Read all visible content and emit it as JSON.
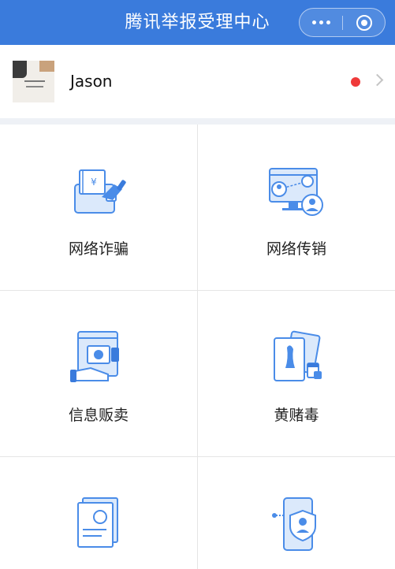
{
  "header": {
    "title": "腾讯举报受理中心",
    "more_icon": "more-dots-icon",
    "close_icon": "miniprogram-close-icon"
  },
  "user": {
    "name": "Jason",
    "has_notification": true
  },
  "categories": [
    {
      "label": "网络诈骗",
      "icon": "wallet-card-icon"
    },
    {
      "label": "网络传销",
      "icon": "network-people-icon"
    },
    {
      "label": "信息贩卖",
      "icon": "data-trade-icon"
    },
    {
      "label": "黄赌毒",
      "icon": "cards-icon"
    },
    {
      "label": "",
      "icon": "legal-document-icon"
    },
    {
      "label": "",
      "icon": "phone-shield-icon"
    }
  ],
  "colors": {
    "brand": "#3a7bdc",
    "icon_blue": "#4a8ce8",
    "icon_light": "#dbe9fb",
    "notify": "#ef3a3a"
  }
}
